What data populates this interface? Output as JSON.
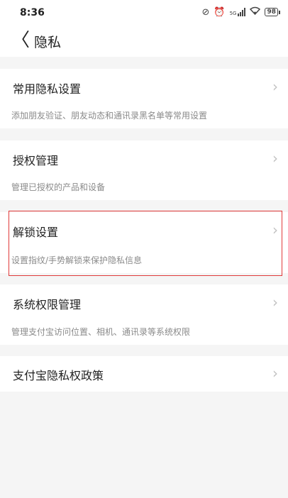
{
  "status_bar": {
    "time": "8:36",
    "icons": [
      "notifications-off-icon",
      "alarm-icon",
      "signal-icon",
      "wifi-icon",
      "battery-icon"
    ],
    "signal_label": "5G",
    "battery_level": "98"
  },
  "header": {
    "back_icon": "back-chevron-icon",
    "back_glyph": "〈",
    "title": "隐私"
  },
  "chevron_glyph": "›",
  "items": [
    {
      "title": "常用隐私设置",
      "desc": "添加朋友验证、朋友动态和通讯录黑名单等常用设置"
    },
    {
      "title": "授权管理",
      "desc": "管理已授权的产品和设备"
    },
    {
      "title": "解锁设置",
      "desc": "设置指纹/手势解锁来保护隐私信息"
    },
    {
      "title": "系统权限管理",
      "desc": "管理支付宝访问位置、相机、通讯录等系统权限"
    },
    {
      "title": "支付宝隐私权政策"
    }
  ],
  "colors": {
    "background": "#f5f5f5",
    "card": "#ffffff",
    "highlight": "#e03a3a",
    "secondary_text": "#8a8a8a"
  }
}
